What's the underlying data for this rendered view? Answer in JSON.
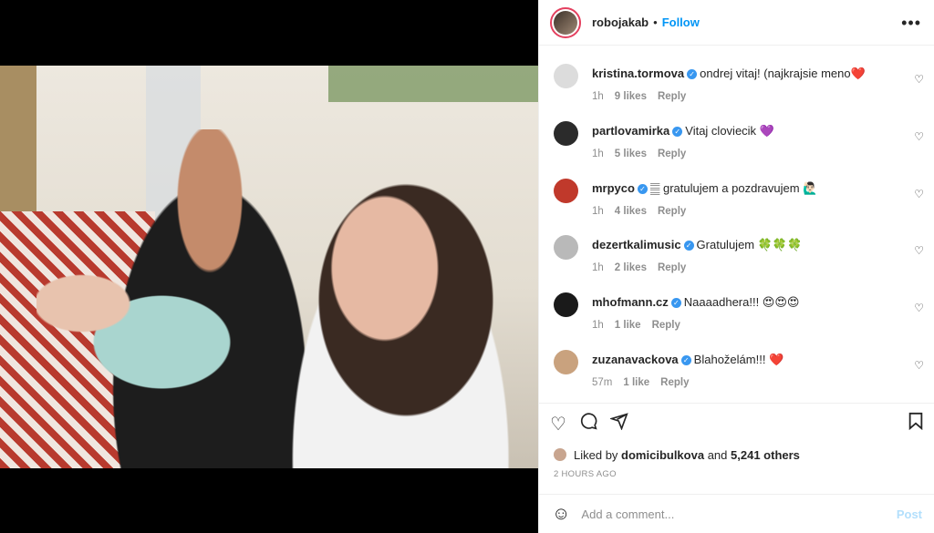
{
  "post": {
    "author": "robojakab",
    "follow_label": "Follow",
    "separator": "•",
    "more_icon": "•••"
  },
  "comments": [
    {
      "user": "kristina.tormova",
      "verified": true,
      "text": "ondrej vitaj! (najkrajsie meno❤️",
      "time": "1h",
      "likes": "9 likes",
      "reply": "Reply",
      "avatar_color": "#dcdcdc"
    },
    {
      "user": "partlovamirka",
      "verified": true,
      "text": "Vitaj cloviecik 💜",
      "time": "1h",
      "likes": "5 likes",
      "reply": "Reply",
      "avatar_color": "#2b2b2b"
    },
    {
      "user": "mrpyco",
      "verified": true,
      "text": "𝄛 gratulujem a pozdravujem 🙋🏻‍♂️",
      "time": "1h",
      "likes": "4 likes",
      "reply": "Reply",
      "avatar_color": "#c0392b"
    },
    {
      "user": "dezertkalimusic",
      "verified": true,
      "text": "Gratulujem 🍀🍀🍀",
      "time": "1h",
      "likes": "2 likes",
      "reply": "Reply",
      "avatar_color": "#b9b9b9"
    },
    {
      "user": "mhofmann.cz",
      "verified": true,
      "text": "Naaaadhera!!! 😍😍😍",
      "time": "1h",
      "likes": "1 like",
      "reply": "Reply",
      "avatar_color": "#1a1a1a"
    },
    {
      "user": "zuzanavackova",
      "verified": true,
      "text": "Blahoželám!!! ❤️",
      "time": "57m",
      "likes": "1 like",
      "reply": "Reply",
      "avatar_color": "#c9a27e"
    }
  ],
  "likes_summary": {
    "prefix": "Liked by",
    "liker": "domicibulkova",
    "and": "and",
    "others": "5,241 others"
  },
  "timestamp": "2 HOURS AGO",
  "add_comment": {
    "placeholder": "Add a comment...",
    "post_label": "Post"
  },
  "colors": {
    "accent": "#0095f6",
    "verified": "#3897f0",
    "muted": "#8e8e8e",
    "post_disabled": "#b2dffc"
  }
}
